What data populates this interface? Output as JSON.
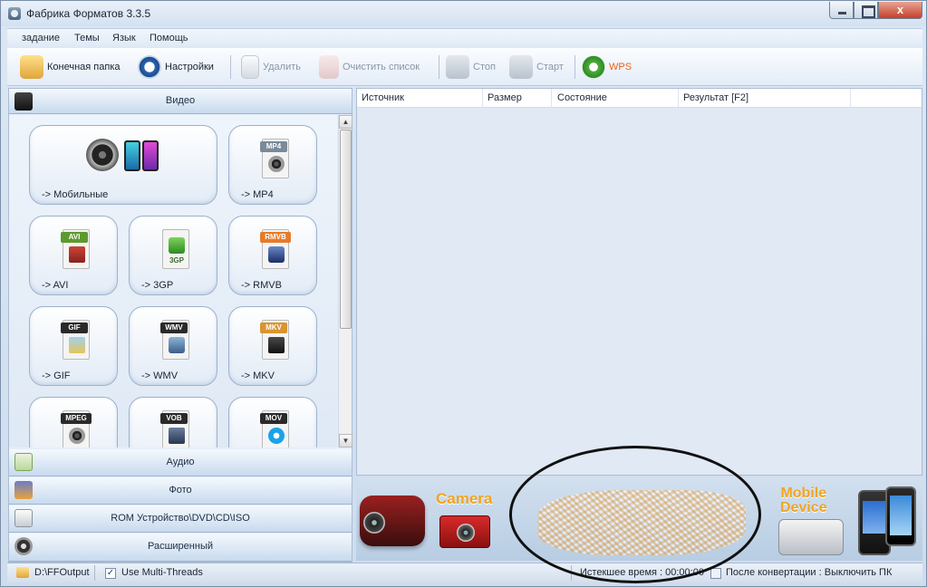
{
  "window": {
    "title": "Фабрика Форматов 3.3.5",
    "close_symbol": "x"
  },
  "menu": [
    "задание",
    "Темы",
    "Язык",
    "Помощь"
  ],
  "toolbar": {
    "output_folder": "Конечная папка",
    "settings": "Настройки",
    "delete": "Удалить",
    "clear_list": "Очистить список",
    "stop": "Стоп",
    "start": "Старт",
    "wps": "WPS"
  },
  "categories": {
    "video": "Видео",
    "audio": "Аудио",
    "photo": "Фото",
    "rom": "ROM Устройство\\DVD\\CD\\ISO",
    "advanced": "Расширенный"
  },
  "tiles": [
    {
      "label": "-> Мобильные"
    },
    {
      "label": "-> MP4",
      "tag": "MP4"
    },
    {
      "label": "-> AVI",
      "tag": "AVI"
    },
    {
      "label": "-> 3GP",
      "tag": "3GP"
    },
    {
      "label": "-> RMVB",
      "tag": "RMVB"
    },
    {
      "label": "-> GIF",
      "tag": "GIF"
    },
    {
      "label": "-> WMV",
      "tag": "WMV"
    },
    {
      "label": "-> MKV",
      "tag": "MKV"
    },
    {
      "tag": "MPEG"
    },
    {
      "tag": "VOB"
    },
    {
      "tag": "MOV"
    }
  ],
  "table": {
    "columns": [
      "Источник",
      "Размер",
      "Состояние",
      "Результат [F2]"
    ]
  },
  "banner": {
    "camera": "Camera",
    "mobile_line1": "Mobile",
    "mobile_line2": "Device"
  },
  "status": {
    "output_path": "D:\\FFOutput",
    "multithreads": "Use Multi-Threads",
    "elapsed": "Истекшее время : 00:00:00",
    "after_convert": "После конвертации : Выключить ПК"
  },
  "colors": {
    "accent": "#f0a41f",
    "wps": "#e8621a"
  }
}
